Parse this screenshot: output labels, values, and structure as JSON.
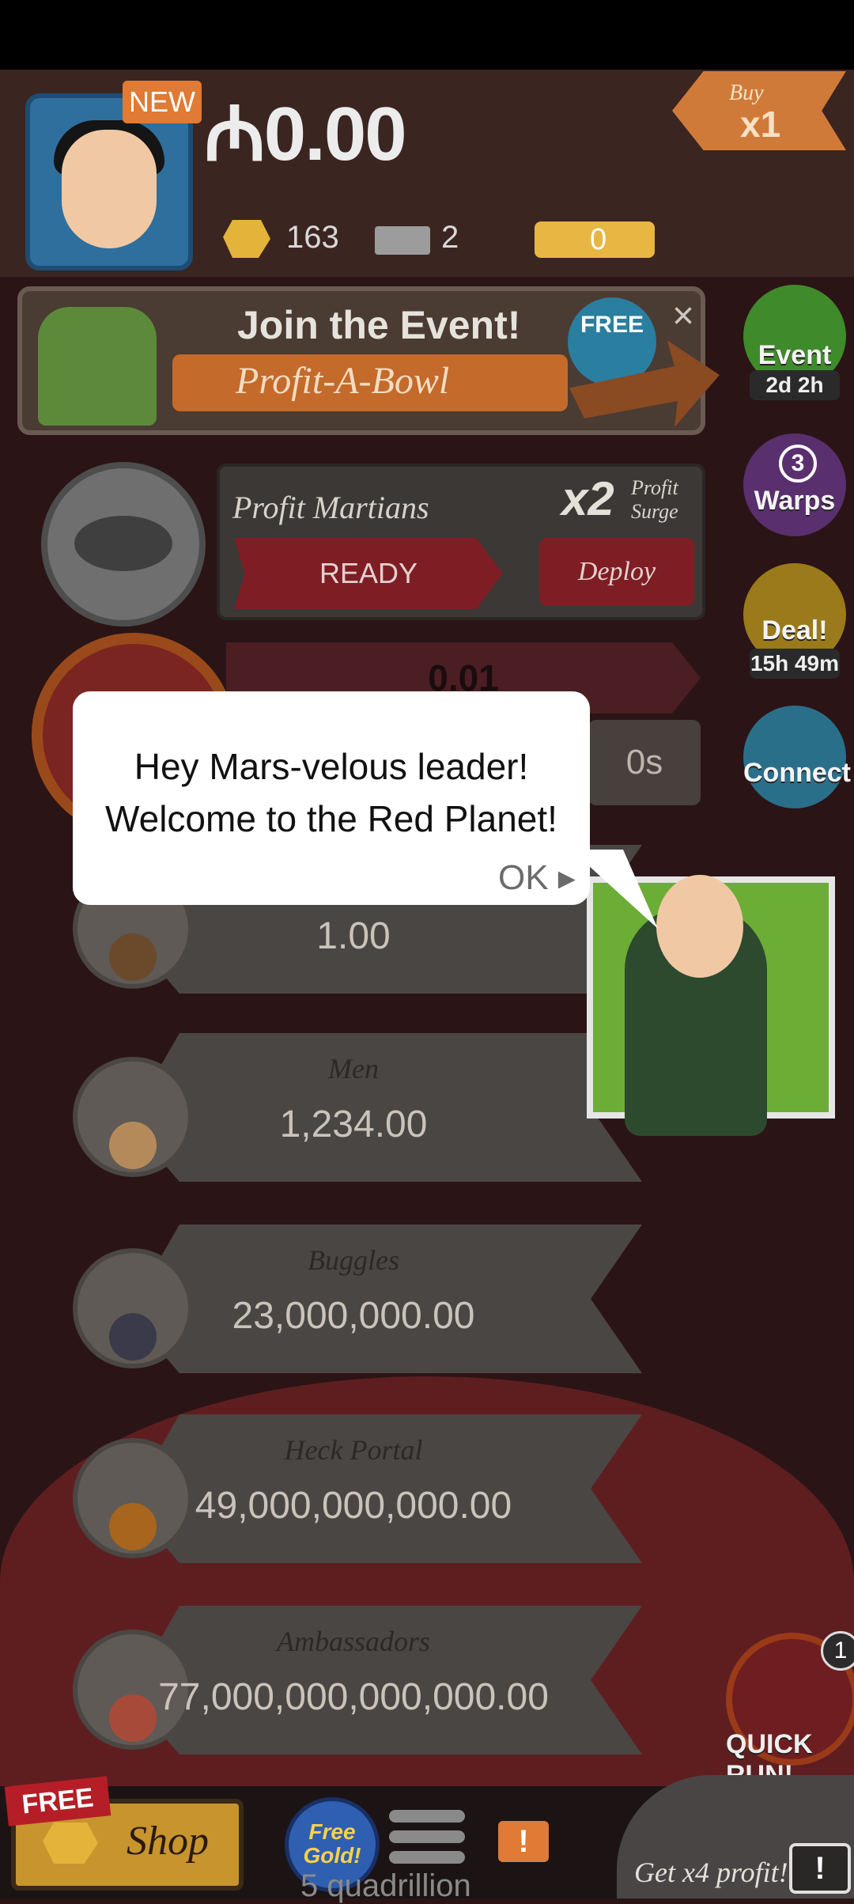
{
  "header": {
    "new_badge": "NEW",
    "money": "₼0.00",
    "gold_count": "163",
    "tickets_count": "2",
    "megatickets_count": "0",
    "buy_label": "Buy",
    "buy_multiplier": "x1"
  },
  "event_banner": {
    "title": "Join the Event!",
    "event_name": "Profit-A-Bowl",
    "free_label": "FREE",
    "close_icon": "×"
  },
  "side_badges": [
    {
      "label": "Event",
      "sub": "2d 2h",
      "color": "#3f8a2a"
    },
    {
      "label": "Warps",
      "count": "3",
      "color": "#5a2f6e"
    },
    {
      "label": "Deal!",
      "sub": "15h 49m",
      "color": "#9a7a1a"
    },
    {
      "label": "Connect",
      "color": "#2a6f8a"
    }
  ],
  "profit_martians": {
    "name": "Profit Martians",
    "multiplier": "x2",
    "surge_line1": "Profit",
    "surge_line2": "Surge",
    "ready_label": "READY",
    "deploy_label": "Deploy"
  },
  "first_business": {
    "progress_value": "0.01",
    "timer": "0s"
  },
  "dialog": {
    "line1": "Hey Mars-velous leader!",
    "line2": "Welcome to the Red Planet!",
    "ok_label": "OK ▸"
  },
  "businesses": [
    {
      "name": "",
      "value": "1.00"
    },
    {
      "name": "Men",
      "value": "1,234.00"
    },
    {
      "name": "Buggles",
      "value": "23,000,000.00"
    },
    {
      "name": "Heck Portal",
      "value": "49,000,000,000.00"
    },
    {
      "name": "Ambassadors",
      "value": "77,000,000,000,000.00"
    }
  ],
  "quick_run": {
    "count": "1",
    "label": "QUICK RUN!"
  },
  "bottom": {
    "free_ribbon": "FREE",
    "shop_label": "Shop",
    "free_gold_label": "Free Gold!",
    "alert_icon": "!",
    "quadrillion_text": "5 quadrillion",
    "get_x4_label": "Get x4 profit!",
    "tv_icon": "!"
  }
}
